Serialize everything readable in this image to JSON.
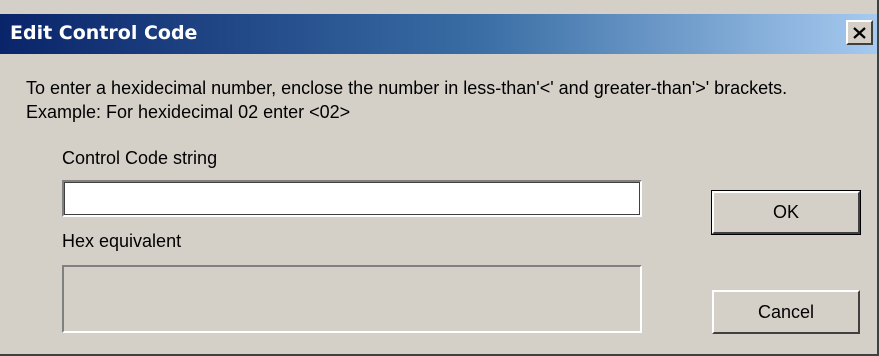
{
  "window": {
    "title": "Edit Control Code",
    "close_glyph": "✕",
    "close_icon": "close-icon"
  },
  "instructions": {
    "text": "To enter a hexidecimal number, enclose the number in less-than'<' and greater-than'>' brackets. Example: For hexidecimal 02 enter <02>"
  },
  "control_code": {
    "label": "Control Code string",
    "value": ""
  },
  "hex": {
    "label": "Hex equivalent",
    "value": ""
  },
  "buttons": {
    "ok_label": "OK",
    "cancel_label": "Cancel"
  },
  "colors": {
    "title_gradient_start": "#0a246a",
    "title_gradient_end": "#a6caf0",
    "dialog_face": "#d4d0c8"
  }
}
